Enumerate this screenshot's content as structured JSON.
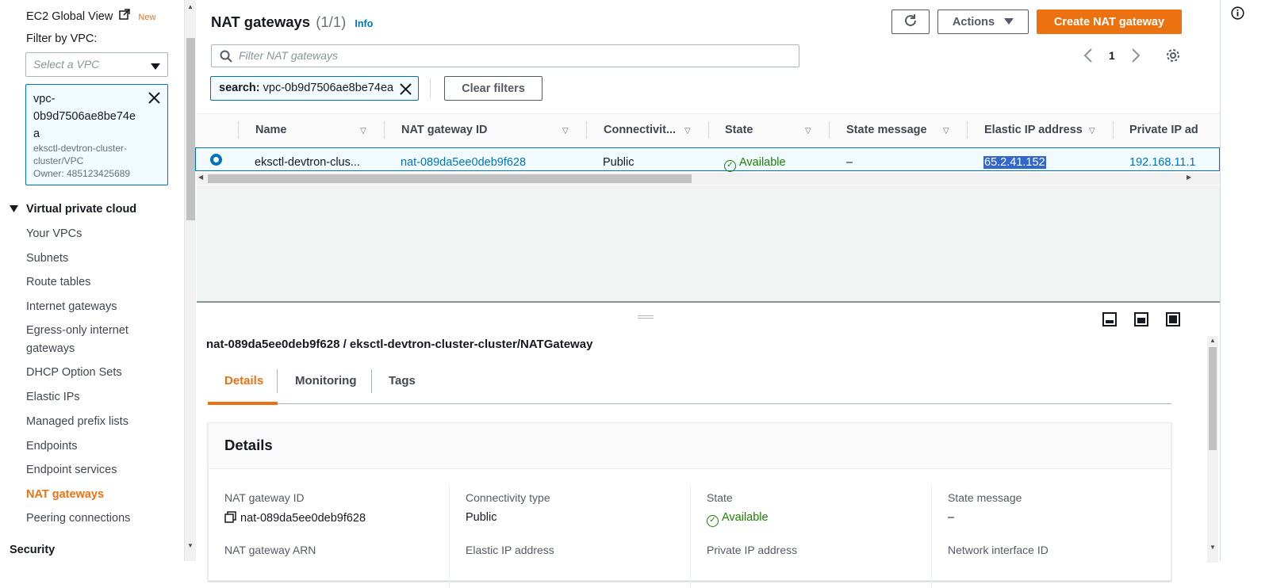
{
  "sidebar": {
    "global_view": "EC2 Global View",
    "new_badge": "New",
    "filter_label": "Filter by VPC:",
    "vpc_select_placeholder": "Select a VPC",
    "vpc_token": {
      "line1": "vpc-",
      "line2": "0b9d7506ae8be74e",
      "line3": "a",
      "name1": "eksctl-devtron-cluster-",
      "name2": "cluster/VPC",
      "owner": "Owner: 485123425689"
    },
    "section": "Virtual private cloud",
    "items": [
      {
        "label": "Your VPCs"
      },
      {
        "label": "Subnets"
      },
      {
        "label": "Route tables"
      },
      {
        "label": "Internet gateways"
      },
      {
        "label": "Egress-only internet"
      },
      {
        "label": "gateways"
      },
      {
        "label": "DHCP Option Sets"
      },
      {
        "label": "Elastic IPs"
      },
      {
        "label": "Managed prefix lists"
      },
      {
        "label": "Endpoints"
      },
      {
        "label": "Endpoint services"
      },
      {
        "label": "NAT gateways"
      },
      {
        "label": "Peering connections"
      },
      {
        "label": "Security"
      }
    ]
  },
  "header": {
    "title": "NAT gateways",
    "count": "(1/1)",
    "info": "Info",
    "actions": "Actions",
    "create": "Create NAT gateway",
    "filter_placeholder": "Filter NAT gateways",
    "page": "1",
    "search_token_key": "search:",
    "search_token_value": "vpc-0b9d7506ae8be74ea",
    "clear_filters": "Clear filters"
  },
  "table": {
    "columns": [
      "Name",
      "NAT gateway ID",
      "Connectivit...",
      "State",
      "State message",
      "Elastic IP address",
      "Private IP ad"
    ],
    "row": {
      "name": "eksctl-devtron-clus...",
      "id": "nat-089da5ee0deb9f628",
      "connectivity": "Public",
      "state": "Available",
      "state_message": "–",
      "elastic_ip": "65.2.41.152",
      "private_ip": "192.168.11.1"
    }
  },
  "detail": {
    "title": "nat-089da5ee0deb9f628 / eksctl-devtron-cluster-cluster/NATGateway",
    "tabs": [
      "Details",
      "Monitoring",
      "Tags"
    ],
    "panel_title": "Details",
    "fields": {
      "id_label": "NAT gateway ID",
      "id_value": "nat-089da5ee0deb9f628",
      "conn_label": "Connectivity type",
      "conn_value": "Public",
      "state_label": "State",
      "state_value": "Available",
      "msg_label": "State message",
      "msg_value": "–",
      "arn_label": "NAT gateway ARN",
      "eip_label": "Elastic IP address",
      "pip_label": "Private IP address",
      "nic_label": "Network interface ID"
    }
  },
  "colors": {
    "accent": "#ec7211",
    "link": "#0073bb",
    "success": "#1d8102"
  }
}
